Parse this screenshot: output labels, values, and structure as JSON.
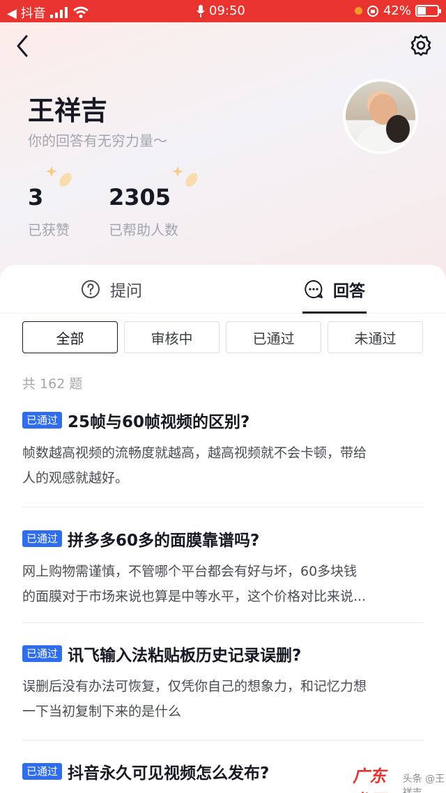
{
  "status_bar": {
    "back_app": "◀ 抖音",
    "signal_icon": "signal-bars-icon",
    "wifi_icon": "wifi-icon",
    "time": "09:50",
    "battery_percent": "42%",
    "battery_level": 0.42
  },
  "profile": {
    "name": "王祥吉",
    "tagline": "你的回答有无穷力量～",
    "likes": {
      "value": "3",
      "label": "已获赞"
    },
    "helped": {
      "value": "2305",
      "label": "已帮助人数"
    }
  },
  "tabs": [
    {
      "label": "提问",
      "icon": "question-circle-icon",
      "active": false
    },
    {
      "label": "回答",
      "icon": "chat-bubble-icon",
      "active": true
    }
  ],
  "filters": [
    {
      "label": "全部",
      "active": true
    },
    {
      "label": "审核中",
      "active": false
    },
    {
      "label": "已通过",
      "active": false
    },
    {
      "label": "未通过",
      "active": false
    }
  ],
  "total_count": "共 162 题",
  "answers": [
    {
      "badge": "已通过",
      "title": "25帧与60帧视频的区别?",
      "desc_line1": "帧数越高视频的流畅度就越高，越高视频就不会卡顿，带给",
      "desc_line2": "人的观感就越好。"
    },
    {
      "badge": "已通过",
      "title": "拼多多60多的面膜靠谱吗?",
      "desc_line1": "网上购物需谨慎，不管哪个平台都会有好与坏，60多块钱",
      "desc_line2": "的面膜对于市场来说也算是中等水平，这个价格对比来说..."
    },
    {
      "badge": "已通过",
      "title": "讯飞输入法粘贴板历史记录误删?",
      "desc_line1": "误删后没有办法可恢复，仅凭你自己的想象力，和记忆力想",
      "desc_line2": "一下当初复制下来的是什么"
    },
    {
      "badge": "已通过",
      "title": "抖音永久可见视频怎么发布?"
    }
  ],
  "watermark": {
    "main": "广东龙网",
    "sub": "头条 @王祥吉"
  },
  "colors": {
    "status_bar": "#e8332e",
    "badge": "#2f6ded",
    "muted": "#a3a6ad"
  }
}
